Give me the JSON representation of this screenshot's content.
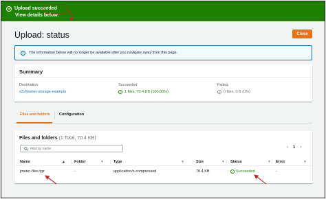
{
  "banner": {
    "title": "Upload succeeded",
    "subtitle": "View details below.",
    "icon": "success-check-icon",
    "color": "#1d8102"
  },
  "header": {
    "title": "Upload: status",
    "close_label": "Close",
    "accent": "#ec7211"
  },
  "info": {
    "icon": "info-icon",
    "text": "The information below will no longer be available after you navigate away from this page."
  },
  "summary": {
    "title": "Summary",
    "destination_label": "Destination",
    "destination_value": "s3://jmeter-storage-example",
    "succeeded_label": "Succeeded",
    "succeeded_value": "1 files, 70.4 KB (100.00%)",
    "failed_label": "Failed",
    "failed_value": "0 files, 0 B (0%)"
  },
  "tabs": [
    "Files and folders",
    "Configuration"
  ],
  "files": {
    "title": "Files and folders",
    "count": "(1 Total, 70.4 KB)",
    "search_placeholder": "Find by name",
    "pager": {
      "prev": "‹",
      "page": "1",
      "next": "›"
    },
    "columns": [
      "Name",
      "Folder",
      "Type",
      "Size",
      "Status",
      "Error"
    ],
    "rows": [
      {
        "name": "jmeter-files.tgz",
        "folder": "-",
        "type": "application/x-compressed",
        "size": "70.4 KB",
        "status": "Succeeded",
        "error": "-"
      }
    ]
  }
}
